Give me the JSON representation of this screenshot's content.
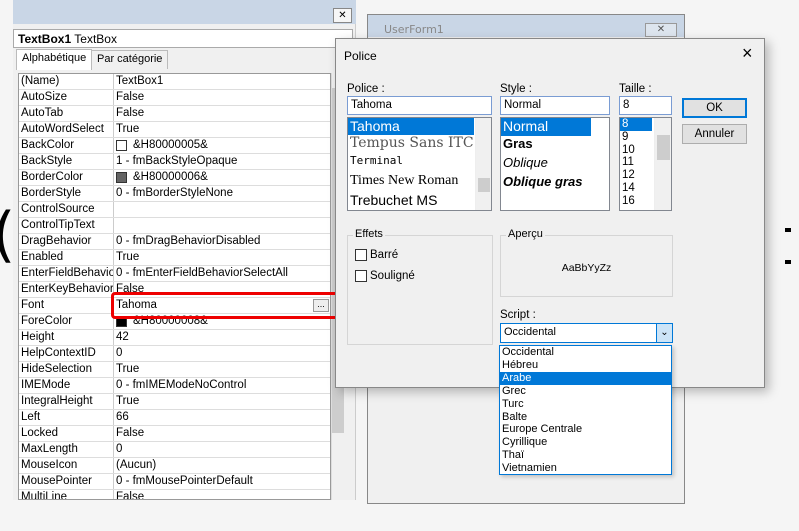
{
  "properties_panel": {
    "object_selector": {
      "name": "TextBox1",
      "type": "TextBox"
    },
    "tabs": [
      "Alphabétique",
      "Par catégorie"
    ],
    "rows": [
      {
        "name": "(Name)",
        "value": "TextBox1"
      },
      {
        "name": "AutoSize",
        "value": "False"
      },
      {
        "name": "AutoTab",
        "value": "False"
      },
      {
        "name": "AutoWordSelect",
        "value": "True"
      },
      {
        "name": "BackColor",
        "value": "&H80000005&",
        "swatch": "#ffffff"
      },
      {
        "name": "BackStyle",
        "value": "1 - fmBackStyleOpaque"
      },
      {
        "name": "BorderColor",
        "value": "&H80000006&",
        "swatch": "#646464"
      },
      {
        "name": "BorderStyle",
        "value": "0 - fmBorderStyleNone"
      },
      {
        "name": "ControlSource",
        "value": ""
      },
      {
        "name": "ControlTipText",
        "value": ""
      },
      {
        "name": "DragBehavior",
        "value": "0 - fmDragBehaviorDisabled"
      },
      {
        "name": "Enabled",
        "value": "True"
      },
      {
        "name": "EnterFieldBehavior",
        "value": "0 - fmEnterFieldBehaviorSelectAll"
      },
      {
        "name": "EnterKeyBehavior",
        "value": "False"
      },
      {
        "name": "Font",
        "value": "Tahoma",
        "button": "..."
      },
      {
        "name": "ForeColor",
        "value": "&H80000008&",
        "swatch": "#000000"
      },
      {
        "name": "Height",
        "value": "42"
      },
      {
        "name": "HelpContextID",
        "value": "0"
      },
      {
        "name": "HideSelection",
        "value": "True"
      },
      {
        "name": "IMEMode",
        "value": "0 - fmIMEModeNoControl"
      },
      {
        "name": "IntegralHeight",
        "value": "True"
      },
      {
        "name": "Left",
        "value": "66"
      },
      {
        "name": "Locked",
        "value": "False"
      },
      {
        "name": "MaxLength",
        "value": "0"
      },
      {
        "name": "MouseIcon",
        "value": "(Aucun)"
      },
      {
        "name": "MousePointer",
        "value": "0 - fmMousePointerDefault"
      },
      {
        "name": "MultiLine",
        "value": "False"
      }
    ]
  },
  "userform": {
    "title": "UserForm1"
  },
  "font_dialog": {
    "title": "Police",
    "font_label": "Police :",
    "font_value": "Tahoma",
    "fonts": [
      "Tahoma",
      "Tempus Sans ITC",
      "Terminal",
      "Times New Roman",
      "Trebuchet MS"
    ],
    "style_label": "Style :",
    "style_value": "Normal",
    "styles": [
      "Normal",
      "Gras",
      "Oblique",
      "Oblique gras"
    ],
    "size_label": "Taille :",
    "size_value": "8",
    "sizes": [
      "8",
      "9",
      "10",
      "11",
      "12",
      "14",
      "16"
    ],
    "ok": "OK",
    "cancel": "Annuler",
    "effects_label": "Effets",
    "strike": "Barré",
    "underline": "Souligné",
    "preview_label": "Aperçu",
    "preview_text": "AaBbYyZz",
    "script_label": "Script :",
    "script_value": "Occidental",
    "scripts": [
      "Occidental",
      "Hébreu",
      "Arabe",
      "Grec",
      "Turc",
      "Balte",
      "Europe Centrale",
      "Cyrillique",
      "Thaï",
      "Vietnamien"
    ],
    "highlighted_script": "Arabe"
  },
  "colors": {
    "selection": "#0078d7",
    "highlight_box": "#ee0000"
  }
}
